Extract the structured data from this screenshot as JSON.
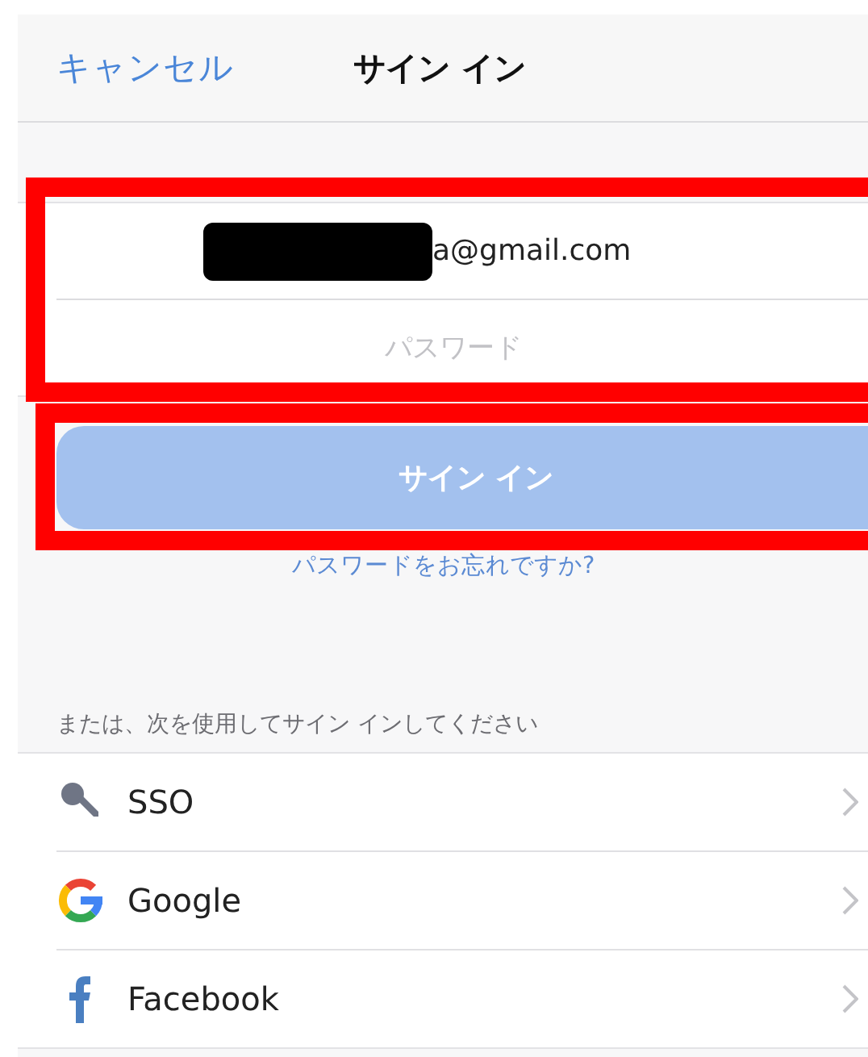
{
  "nav": {
    "cancel": "キャンセル",
    "title": "サイン イン"
  },
  "form": {
    "email_value": "a@gmail.com",
    "password_placeholder": "パスワード"
  },
  "sign_in_button": {
    "label": "サイン イン",
    "disabled": true
  },
  "forgot_link": "パスワードをお忘れですか?",
  "alt_header": "または、次を使用してサイン インしてください",
  "providers": [
    {
      "kind": "key",
      "label": "SSO"
    },
    {
      "kind": "google",
      "label": "Google"
    },
    {
      "kind": "facebook",
      "label": "Facebook"
    }
  ]
}
